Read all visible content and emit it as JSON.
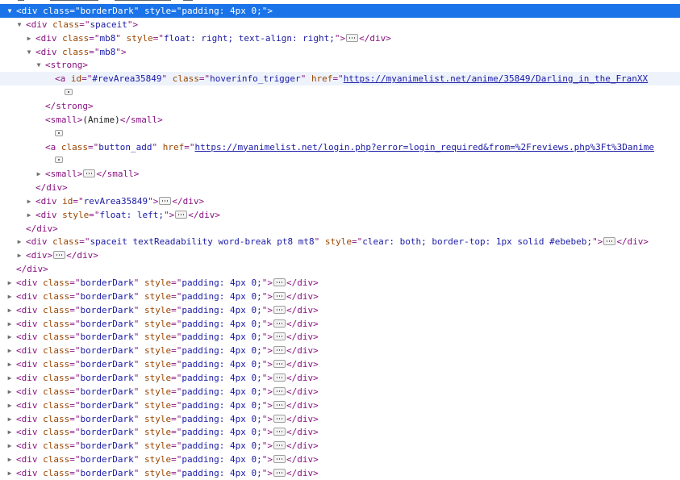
{
  "rows": [
    {
      "indent": 1,
      "tw": "open",
      "sel": true,
      "parts": [
        [
          "t",
          "<div "
        ],
        [
          "a",
          "class"
        ],
        [
          "t",
          "=\""
        ],
        [
          "v",
          "borderDark"
        ],
        [
          "t",
          "\" "
        ],
        [
          "a",
          "style"
        ],
        [
          "t",
          "=\""
        ],
        [
          "v",
          "padding: 4px 0;"
        ],
        [
          "t",
          "\">"
        ]
      ]
    },
    {
      "indent": 2,
      "tw": "open",
      "parts": [
        [
          "t",
          "<div "
        ],
        [
          "a",
          "class"
        ],
        [
          "t",
          "=\""
        ],
        [
          "v",
          "spaceit"
        ],
        [
          "t",
          "\">"
        ]
      ]
    },
    {
      "indent": 3,
      "tw": "closed",
      "parts": [
        [
          "t",
          "<div "
        ],
        [
          "a",
          "class"
        ],
        [
          "t",
          "=\""
        ],
        [
          "v",
          "mb8"
        ],
        [
          "t",
          "\" "
        ],
        [
          "a",
          "style"
        ],
        [
          "t",
          "=\""
        ],
        [
          "v",
          "float: right; text-align: right;"
        ],
        [
          "t",
          "\">"
        ],
        [
          "e",
          ""
        ],
        [
          "t",
          "</div>"
        ]
      ]
    },
    {
      "indent": 3,
      "tw": "open",
      "parts": [
        [
          "t",
          "<div "
        ],
        [
          "a",
          "class"
        ],
        [
          "t",
          "=\""
        ],
        [
          "v",
          "mb8"
        ],
        [
          "t",
          "\">"
        ]
      ]
    },
    {
      "indent": 4,
      "tw": "open",
      "parts": [
        [
          "t",
          "<strong>"
        ]
      ]
    },
    {
      "indent": 5,
      "tw": "none",
      "hover": true,
      "parts": [
        [
          "t",
          "<a "
        ],
        [
          "a",
          "id"
        ],
        [
          "t",
          "=\""
        ],
        [
          "v",
          "#revArea35849"
        ],
        [
          "t",
          "\" "
        ],
        [
          "a",
          "class"
        ],
        [
          "t",
          "=\""
        ],
        [
          "v",
          "hoverinfo_trigger"
        ],
        [
          "t",
          "\" "
        ],
        [
          "a",
          "href"
        ],
        [
          "t",
          "=\""
        ],
        [
          "l",
          "https://myanimelist.net/anime/35849/Darling_in_the_FranXX"
        ]
      ]
    },
    {
      "indent": 6,
      "tw": "none",
      "parts": [
        [
          "w",
          ""
        ]
      ]
    },
    {
      "indent": 4,
      "tw": "none",
      "parts": [
        [
          "t",
          "</strong>"
        ]
      ]
    },
    {
      "indent": 4,
      "tw": "none",
      "parts": [
        [
          "t",
          "<small>"
        ],
        [
          "x",
          "(Anime)"
        ],
        [
          "t",
          "</small>"
        ]
      ]
    },
    {
      "indent": 5,
      "tw": "none",
      "parts": [
        [
          "w",
          ""
        ]
      ]
    },
    {
      "indent": 4,
      "tw": "none",
      "parts": [
        [
          "t",
          "<a "
        ],
        [
          "a",
          "class"
        ],
        [
          "t",
          "=\""
        ],
        [
          "v",
          "button_add"
        ],
        [
          "t",
          "\" "
        ],
        [
          "a",
          "href"
        ],
        [
          "t",
          "=\""
        ],
        [
          "l",
          "https://myanimelist.net/login.php?error=login_required&from=%2Freviews.php%3Ft%3Danime"
        ]
      ]
    },
    {
      "indent": 5,
      "tw": "none",
      "parts": [
        [
          "w",
          ""
        ]
      ]
    },
    {
      "indent": 4,
      "tw": "closed",
      "parts": [
        [
          "t",
          "<small>"
        ],
        [
          "e",
          ""
        ],
        [
          "t",
          "</small>"
        ]
      ]
    },
    {
      "indent": 3,
      "tw": "none",
      "parts": [
        [
          "t",
          "</div>"
        ]
      ]
    },
    {
      "indent": 3,
      "tw": "closed",
      "parts": [
        [
          "t",
          "<div "
        ],
        [
          "a",
          "id"
        ],
        [
          "t",
          "=\""
        ],
        [
          "v",
          "revArea35849"
        ],
        [
          "t",
          "\">"
        ],
        [
          "e",
          ""
        ],
        [
          "t",
          "</div>"
        ]
      ]
    },
    {
      "indent": 3,
      "tw": "closed",
      "parts": [
        [
          "t",
          "<div "
        ],
        [
          "a",
          "style"
        ],
        [
          "t",
          "=\""
        ],
        [
          "v",
          "float: left;"
        ],
        [
          "t",
          "\">"
        ],
        [
          "e",
          ""
        ],
        [
          "t",
          "</div>"
        ]
      ]
    },
    {
      "indent": 2,
      "tw": "none",
      "parts": [
        [
          "t",
          "</div>"
        ]
      ]
    },
    {
      "indent": 2,
      "tw": "closed",
      "parts": [
        [
          "t",
          "<div "
        ],
        [
          "a",
          "class"
        ],
        [
          "t",
          "=\""
        ],
        [
          "v",
          "spaceit textReadability word-break pt8 mt8"
        ],
        [
          "t",
          "\" "
        ],
        [
          "a",
          "style"
        ],
        [
          "t",
          "=\""
        ],
        [
          "v",
          "clear: both; border-top: 1px solid #ebebeb;"
        ],
        [
          "t",
          "\">"
        ],
        [
          "e",
          ""
        ],
        [
          "t",
          "</div>"
        ]
      ]
    },
    {
      "indent": 2,
      "tw": "closed",
      "parts": [
        [
          "t",
          "<div>"
        ],
        [
          "e",
          ""
        ],
        [
          "t",
          "</div>"
        ]
      ]
    },
    {
      "indent": 1,
      "tw": "none",
      "parts": [
        [
          "t",
          "</div>"
        ]
      ]
    },
    {
      "indent": 1,
      "tw": "closed",
      "parts": [
        [
          "t",
          "<div "
        ],
        [
          "a",
          "class"
        ],
        [
          "t",
          "=\""
        ],
        [
          "v",
          "borderDark"
        ],
        [
          "t",
          "\" "
        ],
        [
          "a",
          "style"
        ],
        [
          "t",
          "=\""
        ],
        [
          "v",
          "padding: 4px 0;"
        ],
        [
          "t",
          "\">"
        ],
        [
          "e",
          ""
        ],
        [
          "t",
          "</div>"
        ]
      ]
    },
    {
      "indent": 1,
      "tw": "closed",
      "parts": [
        [
          "t",
          "<div "
        ],
        [
          "a",
          "class"
        ],
        [
          "t",
          "=\""
        ],
        [
          "v",
          "borderDark"
        ],
        [
          "t",
          "\" "
        ],
        [
          "a",
          "style"
        ],
        [
          "t",
          "=\""
        ],
        [
          "v",
          "padding: 4px 0;"
        ],
        [
          "t",
          "\">"
        ],
        [
          "e",
          ""
        ],
        [
          "t",
          "</div>"
        ]
      ]
    },
    {
      "indent": 1,
      "tw": "closed",
      "parts": [
        [
          "t",
          "<div "
        ],
        [
          "a",
          "class"
        ],
        [
          "t",
          "=\""
        ],
        [
          "v",
          "borderDark"
        ],
        [
          "t",
          "\" "
        ],
        [
          "a",
          "style"
        ],
        [
          "t",
          "=\""
        ],
        [
          "v",
          "padding: 4px 0;"
        ],
        [
          "t",
          "\">"
        ],
        [
          "e",
          ""
        ],
        [
          "t",
          "</div>"
        ]
      ]
    },
    {
      "indent": 1,
      "tw": "closed",
      "parts": [
        [
          "t",
          "<div "
        ],
        [
          "a",
          "class"
        ],
        [
          "t",
          "=\""
        ],
        [
          "v",
          "borderDark"
        ],
        [
          "t",
          "\" "
        ],
        [
          "a",
          "style"
        ],
        [
          "t",
          "=\""
        ],
        [
          "v",
          "padding: 4px 0;"
        ],
        [
          "t",
          "\">"
        ],
        [
          "e",
          ""
        ],
        [
          "t",
          "</div>"
        ]
      ]
    },
    {
      "indent": 1,
      "tw": "closed",
      "parts": [
        [
          "t",
          "<div "
        ],
        [
          "a",
          "class"
        ],
        [
          "t",
          "=\""
        ],
        [
          "v",
          "borderDark"
        ],
        [
          "t",
          "\" "
        ],
        [
          "a",
          "style"
        ],
        [
          "t",
          "=\""
        ],
        [
          "v",
          "padding: 4px 0;"
        ],
        [
          "t",
          "\">"
        ],
        [
          "e",
          ""
        ],
        [
          "t",
          "</div>"
        ]
      ]
    },
    {
      "indent": 1,
      "tw": "closed",
      "parts": [
        [
          "t",
          "<div "
        ],
        [
          "a",
          "class"
        ],
        [
          "t",
          "=\""
        ],
        [
          "v",
          "borderDark"
        ],
        [
          "t",
          "\" "
        ],
        [
          "a",
          "style"
        ],
        [
          "t",
          "=\""
        ],
        [
          "v",
          "padding: 4px 0;"
        ],
        [
          "t",
          "\">"
        ],
        [
          "e",
          ""
        ],
        [
          "t",
          "</div>"
        ]
      ]
    },
    {
      "indent": 1,
      "tw": "closed",
      "parts": [
        [
          "t",
          "<div "
        ],
        [
          "a",
          "class"
        ],
        [
          "t",
          "=\""
        ],
        [
          "v",
          "borderDark"
        ],
        [
          "t",
          "\" "
        ],
        [
          "a",
          "style"
        ],
        [
          "t",
          "=\""
        ],
        [
          "v",
          "padding: 4px 0;"
        ],
        [
          "t",
          "\">"
        ],
        [
          "e",
          ""
        ],
        [
          "t",
          "</div>"
        ]
      ]
    },
    {
      "indent": 1,
      "tw": "closed",
      "parts": [
        [
          "t",
          "<div "
        ],
        [
          "a",
          "class"
        ],
        [
          "t",
          "=\""
        ],
        [
          "v",
          "borderDark"
        ],
        [
          "t",
          "\" "
        ],
        [
          "a",
          "style"
        ],
        [
          "t",
          "=\""
        ],
        [
          "v",
          "padding: 4px 0;"
        ],
        [
          "t",
          "\">"
        ],
        [
          "e",
          ""
        ],
        [
          "t",
          "</div>"
        ]
      ]
    },
    {
      "indent": 1,
      "tw": "closed",
      "parts": [
        [
          "t",
          "<div "
        ],
        [
          "a",
          "class"
        ],
        [
          "t",
          "=\""
        ],
        [
          "v",
          "borderDark"
        ],
        [
          "t",
          "\" "
        ],
        [
          "a",
          "style"
        ],
        [
          "t",
          "=\""
        ],
        [
          "v",
          "padding: 4px 0;"
        ],
        [
          "t",
          "\">"
        ],
        [
          "e",
          ""
        ],
        [
          "t",
          "</div>"
        ]
      ]
    },
    {
      "indent": 1,
      "tw": "closed",
      "parts": [
        [
          "t",
          "<div "
        ],
        [
          "a",
          "class"
        ],
        [
          "t",
          "=\""
        ],
        [
          "v",
          "borderDark"
        ],
        [
          "t",
          "\" "
        ],
        [
          "a",
          "style"
        ],
        [
          "t",
          "=\""
        ],
        [
          "v",
          "padding: 4px 0;"
        ],
        [
          "t",
          "\">"
        ],
        [
          "e",
          ""
        ],
        [
          "t",
          "</div>"
        ]
      ]
    },
    {
      "indent": 1,
      "tw": "closed",
      "parts": [
        [
          "t",
          "<div "
        ],
        [
          "a",
          "class"
        ],
        [
          "t",
          "=\""
        ],
        [
          "v",
          "borderDark"
        ],
        [
          "t",
          "\" "
        ],
        [
          "a",
          "style"
        ],
        [
          "t",
          "=\""
        ],
        [
          "v",
          "padding: 4px 0;"
        ],
        [
          "t",
          "\">"
        ],
        [
          "e",
          ""
        ],
        [
          "t",
          "</div>"
        ]
      ]
    },
    {
      "indent": 1,
      "tw": "closed",
      "parts": [
        [
          "t",
          "<div "
        ],
        [
          "a",
          "class"
        ],
        [
          "t",
          "=\""
        ],
        [
          "v",
          "borderDark"
        ],
        [
          "t",
          "\" "
        ],
        [
          "a",
          "style"
        ],
        [
          "t",
          "=\""
        ],
        [
          "v",
          "padding: 4px 0;"
        ],
        [
          "t",
          "\">"
        ],
        [
          "e",
          ""
        ],
        [
          "t",
          "</div>"
        ]
      ]
    },
    {
      "indent": 1,
      "tw": "closed",
      "parts": [
        [
          "t",
          "<div "
        ],
        [
          "a",
          "class"
        ],
        [
          "t",
          "=\""
        ],
        [
          "v",
          "borderDark"
        ],
        [
          "t",
          "\" "
        ],
        [
          "a",
          "style"
        ],
        [
          "t",
          "=\""
        ],
        [
          "v",
          "padding: 4px 0;"
        ],
        [
          "t",
          "\">"
        ],
        [
          "e",
          ""
        ],
        [
          "t",
          "</div>"
        ]
      ]
    },
    {
      "indent": 1,
      "tw": "closed",
      "parts": [
        [
          "t",
          "<div "
        ],
        [
          "a",
          "class"
        ],
        [
          "t",
          "=\""
        ],
        [
          "v",
          "borderDark"
        ],
        [
          "t",
          "\" "
        ],
        [
          "a",
          "style"
        ],
        [
          "t",
          "=\""
        ],
        [
          "v",
          "padding: 4px 0;"
        ],
        [
          "t",
          "\">"
        ],
        [
          "e",
          ""
        ],
        [
          "t",
          "</div>"
        ]
      ]
    },
    {
      "indent": 1,
      "tw": "closed",
      "parts": [
        [
          "t",
          "<div "
        ],
        [
          "a",
          "class"
        ],
        [
          "t",
          "=\""
        ],
        [
          "v",
          "borderDark"
        ],
        [
          "t",
          "\" "
        ],
        [
          "a",
          "style"
        ],
        [
          "t",
          "=\""
        ],
        [
          "v",
          "padding: 4px 0;"
        ],
        [
          "t",
          "\">"
        ],
        [
          "e",
          ""
        ],
        [
          "t",
          "</div>"
        ]
      ]
    }
  ],
  "colors": {
    "selection": "#1a73e8",
    "tag": "#881280",
    "attr_name": "#994500",
    "attr_value": "#1a1aa6",
    "hover_row": "#eef3fb"
  }
}
